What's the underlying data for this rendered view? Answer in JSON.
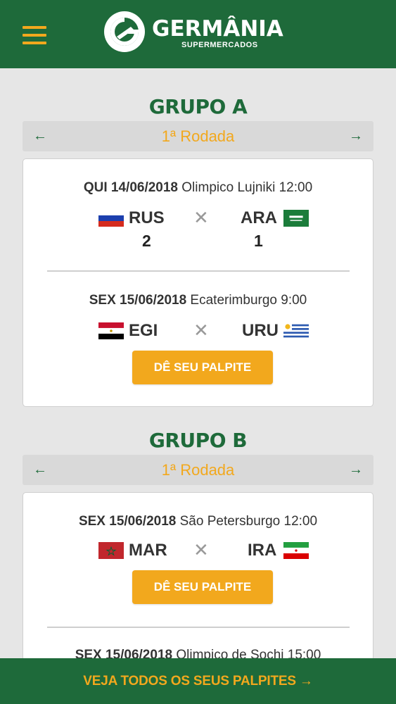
{
  "header": {
    "brand": "GERMÂNIA",
    "brand_sub": "SUPERMERCADOS",
    "menu_icon": "hamburger-menu-icon"
  },
  "colors": {
    "green": "#1e6a3a",
    "orange": "#f2a81d"
  },
  "groups": [
    {
      "title": "GRUPO A",
      "round": "1ª Rodada",
      "matches": [
        {
          "day": "QUI 14/06/2018",
          "venue": "Olimpico Lujniki 12:00",
          "home": "RUS",
          "away": "ARA",
          "home_score": "2",
          "away_score": "1",
          "home_flag": "russia-flag-icon",
          "away_flag": "saudi-arabia-flag-icon"
        },
        {
          "day": "SEX 15/06/2018",
          "venue": "Ecaterimburgo 9:00",
          "home": "EGI",
          "away": "URU",
          "home_flag": "egypt-flag-icon",
          "away_flag": "uruguay-flag-icon",
          "button": "DÊ SEU PALPITE"
        }
      ]
    },
    {
      "title": "GRUPO B",
      "round": "1ª Rodada",
      "matches": [
        {
          "day": "SEX 15/06/2018",
          "venue": "São Petersburgo 12:00",
          "home": "MAR",
          "away": "IRA",
          "home_flag": "morocco-flag-icon",
          "away_flag": "iran-flag-icon",
          "button": "DÊ SEU PALPITE"
        },
        {
          "day": "SEX 15/06/2018",
          "venue": "Olimpico de Sochi 15:00"
        }
      ]
    }
  ],
  "vs_symbol": "✕",
  "prev_arrow": "←",
  "next_arrow": "→",
  "footer": {
    "label": "VEJA TODOS OS SEUS PALPITES →"
  }
}
